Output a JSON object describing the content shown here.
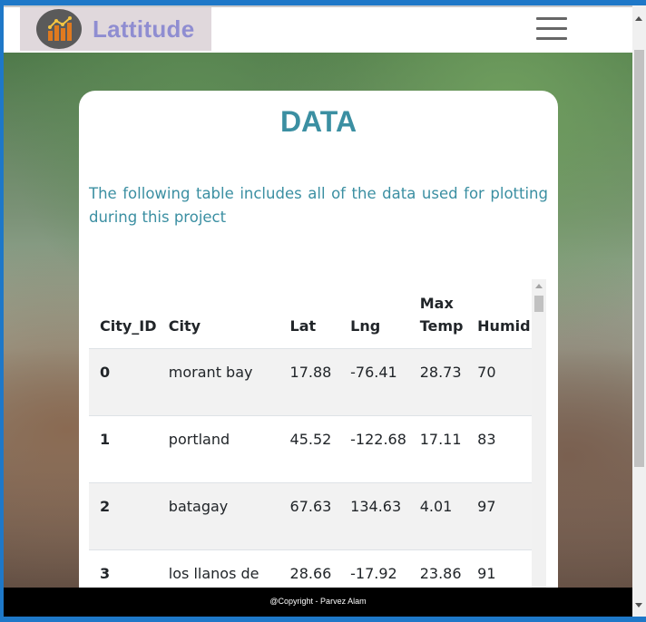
{
  "brand": {
    "name": "Lattitude",
    "logo_icon": "bar-chart-icon"
  },
  "nav": {
    "menu_icon": "hamburger-menu-icon"
  },
  "card": {
    "title": "DATA",
    "description": "The following table includes all of the data used for plotting during this project"
  },
  "table": {
    "headers": [
      "City_ID",
      "City",
      "Lat",
      "Lng",
      "Max Temp",
      "Humid"
    ],
    "rows": [
      [
        "0",
        "morant bay",
        "17.88",
        "-76.41",
        "28.73",
        "70"
      ],
      [
        "1",
        "portland",
        "45.52",
        "-122.68",
        "17.11",
        "83"
      ],
      [
        "2",
        "batagay",
        "67.63",
        "134.63",
        "4.01",
        "97"
      ],
      [
        "3",
        "los llanos de aridane",
        "28.66",
        "-17.92",
        "23.86",
        "91"
      ]
    ]
  },
  "footer": {
    "text": "@Copyright - Parvez Alam"
  },
  "colors": {
    "accent": "#3b8fa2",
    "brand_text": "#8f8dd1",
    "footer_bg": "#000000"
  }
}
